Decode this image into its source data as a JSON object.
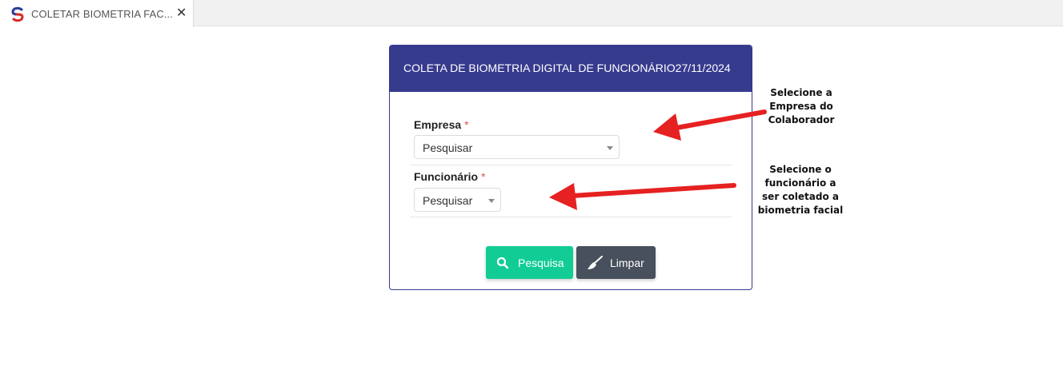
{
  "tab": {
    "title": "COLETAR BIOMETRIA FAC...",
    "close": "✕",
    "logo_icon": "app-logo-icon"
  },
  "card": {
    "title": "COLETA DE BIOMETRIA DIGITAL DE FUNCIONÁRIO27/11/2024"
  },
  "form": {
    "empresa": {
      "label": "Empresa",
      "required_mark": "*",
      "value": "Pesquisar"
    },
    "funcionario": {
      "label": "Funcionário",
      "required_mark": "*",
      "value": "Pesquisar"
    }
  },
  "buttons": {
    "search": {
      "label": "Pesquisa",
      "icon": "search-icon"
    },
    "clear": {
      "label": "Limpar",
      "icon": "broom-icon"
    }
  },
  "annotations": {
    "empresa": [
      "Selecione a",
      "Empresa do",
      "Colaborador"
    ],
    "funcionario": [
      "Selecione o",
      "funcionário a",
      "ser coletado a",
      "biometria facial"
    ]
  },
  "colors": {
    "header": "#363b8e",
    "search_button": "#12cc95",
    "clear_button": "#47505c",
    "arrow": "#e62121",
    "required": "#d9534f"
  }
}
